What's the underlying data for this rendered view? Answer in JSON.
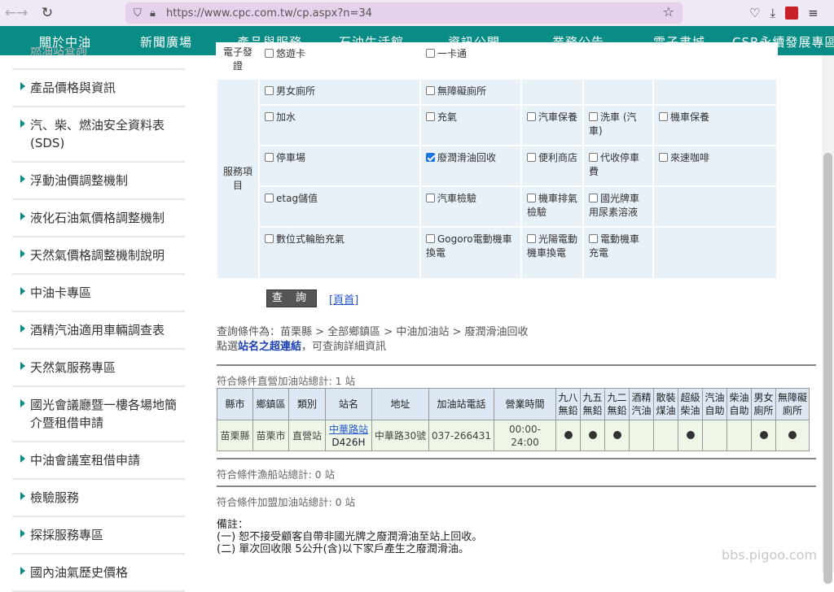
{
  "browser": {
    "url": "https://www.cpc.com.tw/cp.aspx?n=34"
  },
  "nav": {
    "items": [
      "關於中油",
      "新聞廣場",
      "產品與服務",
      "石油生活館",
      "資訊公開",
      "業務公告",
      "電子書城",
      "CSR永續發展專區"
    ]
  },
  "sidebar": {
    "cut_top": "燃油站查詢",
    "items": [
      "產品價格與資訊",
      "汽、柴、燃油安全資料表(SDS)",
      "浮動油價調整機制",
      "液化石油氣價格調整機制",
      "天然氣價格調整機制說明",
      "中油卡專區",
      "酒精汽油適用車輛調查表",
      "天然氣服務專區",
      "國光會議廳暨一樓各場地簡介暨租借申請",
      "中油會議室租借申請",
      "檢驗服務",
      "探採服務專區",
      "國內油氣歷史價格"
    ]
  },
  "service_table": {
    "top_cut_header": "電子發證",
    "top_cut_opts": [
      "悠遊卡",
      "一卡通"
    ],
    "header": "服務項目",
    "rows": [
      [
        {
          "label": "男女廁所",
          "checked": false
        },
        {
          "label": "無障礙廁所",
          "checked": false
        }
      ],
      [
        {
          "label": "加水",
          "checked": false
        },
        {
          "label": "充氣",
          "checked": false
        },
        {
          "label": "汽車保養",
          "checked": false
        },
        {
          "label": "洗車 (汽車)",
          "checked": false
        },
        {
          "label": "機車保養",
          "checked": false
        }
      ],
      [
        {
          "label": "停車場",
          "checked": false
        },
        {
          "label": "廢潤滑油回收",
          "checked": true
        },
        {
          "label": "便利商店",
          "checked": false
        },
        {
          "label": "代收停車費",
          "checked": false
        },
        {
          "label": "來速咖啡",
          "checked": false
        }
      ],
      [
        {
          "label": "etag儲值",
          "checked": false
        },
        {
          "label": "汽車檢驗",
          "checked": false
        },
        {
          "label": "機車排氣檢驗",
          "checked": false
        },
        {
          "label": "國光牌車用尿素溶液",
          "checked": false
        }
      ],
      [
        {
          "label": "數位式輪胎充氣",
          "checked": false
        },
        {
          "label": "Gogoro電動機車換電",
          "checked": false
        },
        {
          "label": "光陽電動機車換電",
          "checked": false
        },
        {
          "label": "電動機車充電",
          "checked": false
        }
      ]
    ]
  },
  "actions": {
    "query_label": "查 詢",
    "home_label": "[頁首]"
  },
  "conditions": {
    "line1": "查詢條件為：苗栗縣 > 全部鄉鎮區 > 中油加油站 > 廢潤滑油回收",
    "line2_pre": "點選",
    "line2_link": "站名之超連結",
    "line2_post": "，可查詢詳細資訊"
  },
  "results": {
    "direct_count": "符合條件直營加油站總計: 1 站",
    "columns": [
      "縣市",
      "鄉鎮區",
      "類別",
      "站名",
      "地址",
      "加油站電話",
      "營業時間",
      "九八無鉛",
      "九五無鉛",
      "九二無鉛",
      "酒精汽油",
      "散裝煤油",
      "超級柴油",
      "汽油自助",
      "柴油自助",
      "男女廁所",
      "無障礙廁所"
    ],
    "rows": [
      {
        "county": "苗栗縣",
        "district": "苗栗市",
        "type": "直營站",
        "name": "中華路站",
        "code": "D426H",
        "address": "中華路30號",
        "phone": "037-266431",
        "hours": "00:00-24:00",
        "services": [
          true,
          true,
          true,
          false,
          false,
          true,
          false,
          false,
          true,
          true
        ]
      }
    ],
    "fishing_count": "符合條件漁船站總計: 0 站",
    "franchise_count": "符合條件加盟加油站總計: 0 站"
  },
  "notes": {
    "title": "備註：",
    "items": [
      "(一) 恕不接受顧客自帶非國光牌之廢潤滑油至站上回收。",
      "(二) 單次回收限 5公升(含)以下家戶產生之廢潤滑油。"
    ]
  },
  "watermark": "bbs.pigoo.com"
}
